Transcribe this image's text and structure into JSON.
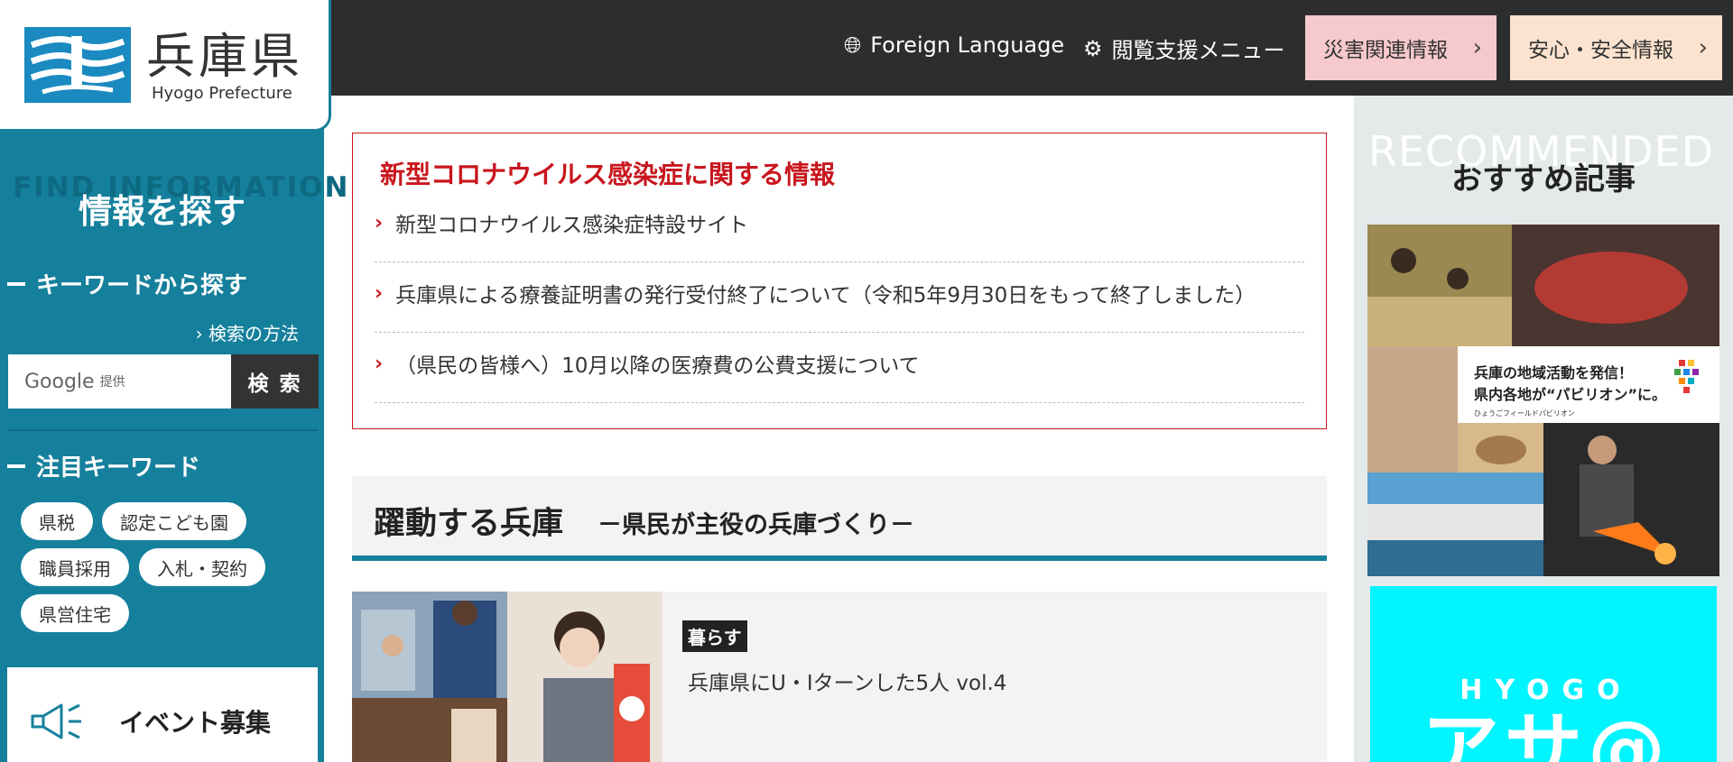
{
  "header": {
    "logo_jp": "兵庫県",
    "logo_en": "Hyogo Prefecture",
    "foreign_language": "Foreign Language",
    "accessibility_menu": "閲覧支援メニュー",
    "disaster_info": "災害関連情報",
    "safety_info": "安心・安全情報",
    "colors": {
      "disaster_bg": "#f6c9cc",
      "safety_bg": "#fbe3cf",
      "bar": "#2d2d2d"
    }
  },
  "sidebar": {
    "watermark": "FIND INFORMATION",
    "title": "情報を探す",
    "keyword_heading": "キーワードから探す",
    "search_method": "› 検索の方法",
    "search": {
      "google": "Google",
      "provided": "提供",
      "button": "検 索"
    },
    "featured_heading": "注目キーワード",
    "keywords": [
      "県税",
      "認定こども園",
      "職員採用",
      "入札・契約",
      "県営住宅"
    ],
    "event": "イベント募集",
    "color": "#15809c"
  },
  "corona": {
    "title": "新型コロナウイルス感染症に関する情報",
    "items": [
      "新型コロナウイルス感染症特設サイト",
      "兵庫県による療養証明書の発行受付終了について（令和5年9月30日をもって終了しました）",
      "（県民の皆様へ）10月以降の医療費の公費支援について"
    ]
  },
  "section": {
    "title": "躍動する兵庫",
    "subtitle": "－県民が主役の兵庫づくり－"
  },
  "card": {
    "tag": "暮らす",
    "title": "兵庫県にU・Iターンした5人 vol.4"
  },
  "recommended": {
    "watermark": "RECOMMENDED",
    "title": "おすすめ記事",
    "banner1_line1": "兵庫の地域活動を発信！",
    "banner1_line2": "県内各地が“パビリオン”に。",
    "banner1_sub": "ひょうごフィールドパビリオン",
    "banner2_top": "HYOGO",
    "banner2_big": "アサ@"
  }
}
